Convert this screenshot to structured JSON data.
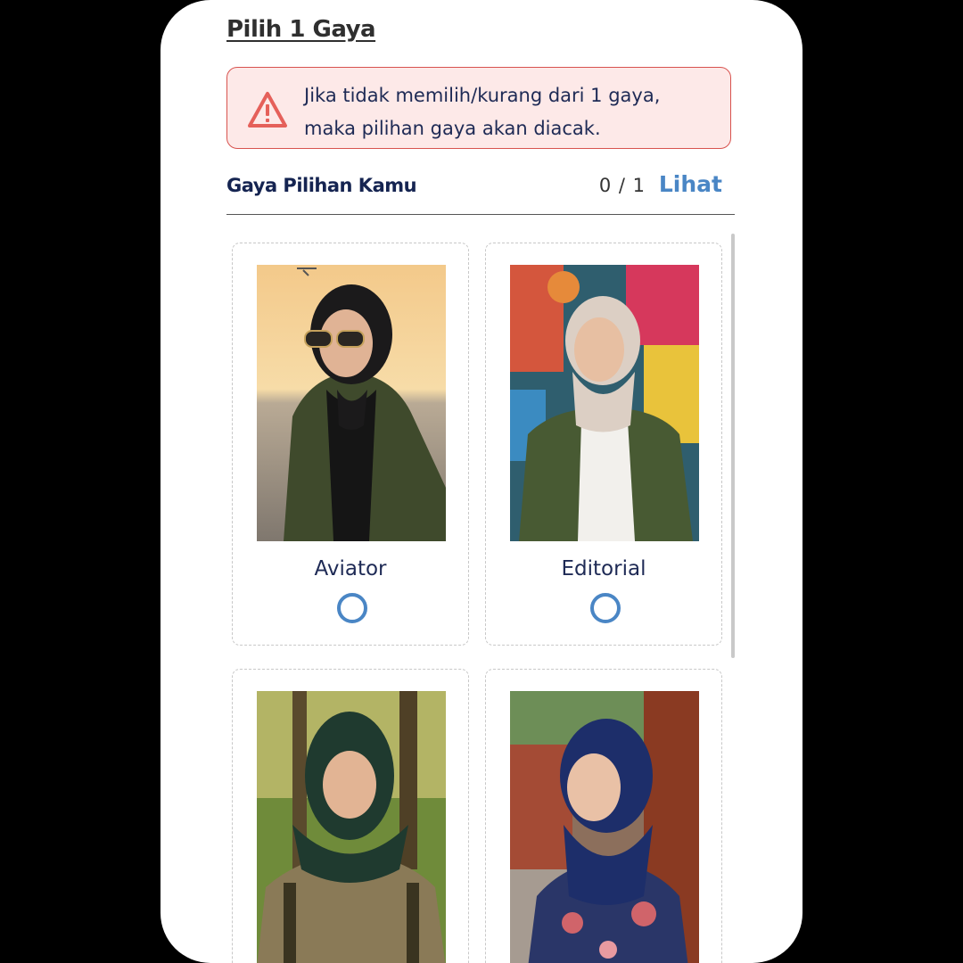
{
  "header": {
    "title": "Pilih 1 Gaya"
  },
  "alert": {
    "icon": "warning-icon",
    "line1": "Jika tidak memilih/kurang dari 1 gaya,",
    "line2": "maka pilihan gaya akan diacak.",
    "color": "#d8534f"
  },
  "selection": {
    "label": "Gaya Pilihan Kamu",
    "count": "0 / 1",
    "link": "Lihat"
  },
  "styles": [
    {
      "name": "Aviator",
      "selected": false
    },
    {
      "name": "Editorial",
      "selected": false
    },
    {
      "name": "",
      "selected": false
    },
    {
      "name": "",
      "selected": false
    }
  ],
  "colors": {
    "accent": "#4a86c5",
    "heading": "#152451"
  }
}
